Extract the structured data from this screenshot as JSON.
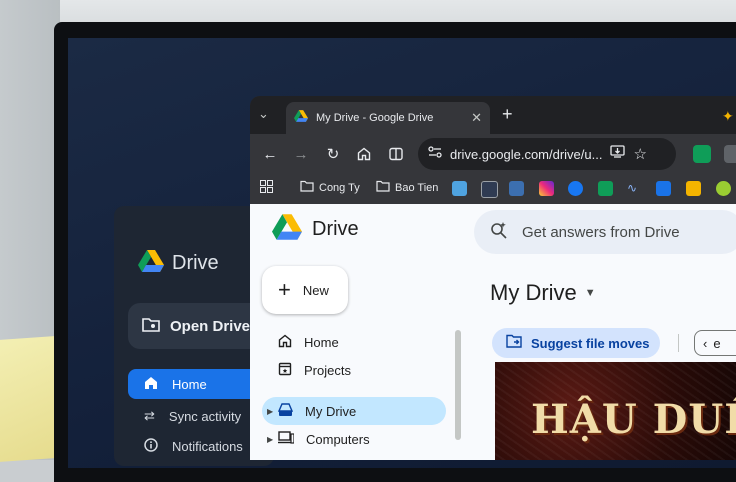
{
  "background_app": {
    "brand": "Drive",
    "open_button": "Open Drive f",
    "nav": [
      "Home",
      "Sync activity",
      "Notifications"
    ]
  },
  "browser": {
    "tab_title": "My Drive - Google Drive",
    "url": "drive.google.com/drive/u...",
    "bookmarks": [
      "Cong Ty",
      "Bao Tien"
    ]
  },
  "drive": {
    "brand": "Drive",
    "search_placeholder": "Get answers from Drive",
    "new_label": "New",
    "nav": [
      "Home",
      "Projects",
      "My Drive",
      "Computers"
    ],
    "view_title": "My Drive",
    "suggest_label": "Suggest file moves",
    "pill_label": "e",
    "thumbnail_text": "HẬU DUỆ"
  },
  "colors": {
    "accent": "#1a73e8",
    "nav_active": "#c2e7ff",
    "suggest_bg": "#d3e3fd"
  },
  "icons": [
    "drive-logo-icon",
    "folder-open-icon",
    "home-icon",
    "sync-icon",
    "info-icon",
    "chevron-down-icon",
    "close-icon",
    "plus-icon",
    "back-icon",
    "forward-icon",
    "reload-icon",
    "home-icon",
    "split-view-icon",
    "site-info-icon",
    "install-icon",
    "star-icon",
    "apps-icon",
    "folder-icon",
    "sparkle-search-icon",
    "projects-icon",
    "my-drive-icon",
    "computer-icon",
    "move-file-icon"
  ]
}
